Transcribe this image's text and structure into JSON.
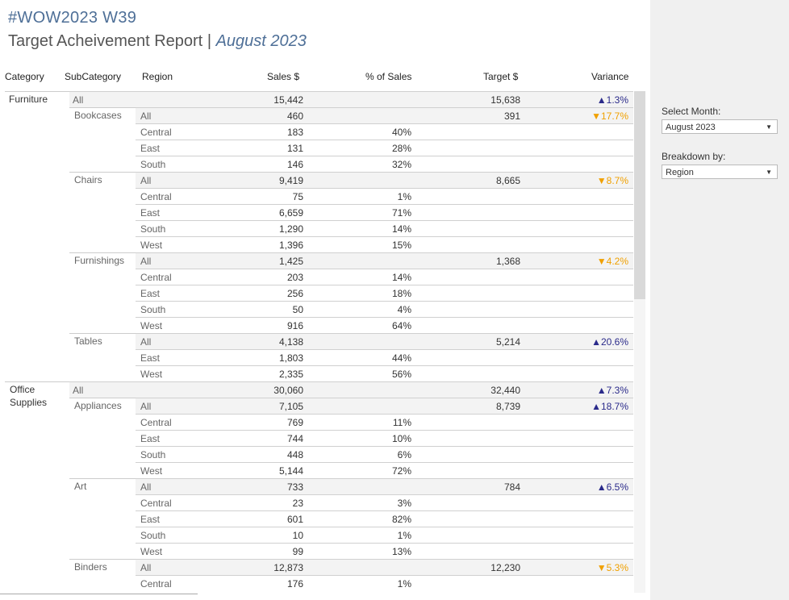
{
  "header": {
    "title": "#WOW2023 W39",
    "report": "Target Acheivement Report",
    "separator": "|",
    "month": "August 2023"
  },
  "columns": {
    "category": "Category",
    "subcategory": "SubCategory",
    "region": "Region",
    "sales": "Sales $",
    "pct": "% of Sales",
    "target": "Target $",
    "variance": "Variance"
  },
  "controls": {
    "month_label": "Select Month:",
    "month_value": "August 2023",
    "breakdown_label": "Breakdown by:",
    "breakdown_value": "Region"
  },
  "categories": [
    {
      "name": "Furniture",
      "row": 0
    },
    {
      "name": "Office\nSupplies",
      "row": 18
    }
  ],
  "subcategories": [
    {
      "name": "Bookcases",
      "row": 1
    },
    {
      "name": "Chairs",
      "row": 5
    },
    {
      "name": "Furnishings",
      "row": 10
    },
    {
      "name": "Tables",
      "row": 15
    },
    {
      "name": "Appliances",
      "row": 19
    },
    {
      "name": "Art",
      "row": 24
    },
    {
      "name": "Binders",
      "row": 29
    }
  ],
  "rows": [
    {
      "level": "cat",
      "label": "All",
      "sales": "15,442",
      "pct": "",
      "target": "15,638",
      "var": "▲1.3%",
      "dir": "up"
    },
    {
      "level": "sub",
      "label": "All",
      "sales": "460",
      "pct": "",
      "target": "391",
      "var": "▼17.7%",
      "dir": "down"
    },
    {
      "level": "reg",
      "label": "Central",
      "sales": "183",
      "pct": "40%",
      "target": "",
      "var": "",
      "dir": ""
    },
    {
      "level": "reg",
      "label": "East",
      "sales": "131",
      "pct": "28%",
      "target": "",
      "var": "",
      "dir": ""
    },
    {
      "level": "reg",
      "label": "South",
      "sales": "146",
      "pct": "32%",
      "target": "",
      "var": "",
      "dir": ""
    },
    {
      "level": "sub",
      "label": "All",
      "sales": "9,419",
      "pct": "",
      "target": "8,665",
      "var": "▼8.7%",
      "dir": "down"
    },
    {
      "level": "reg",
      "label": "Central",
      "sales": "75",
      "pct": "1%",
      "target": "",
      "var": "",
      "dir": ""
    },
    {
      "level": "reg",
      "label": "East",
      "sales": "6,659",
      "pct": "71%",
      "target": "",
      "var": "",
      "dir": ""
    },
    {
      "level": "reg",
      "label": "South",
      "sales": "1,290",
      "pct": "14%",
      "target": "",
      "var": "",
      "dir": ""
    },
    {
      "level": "reg",
      "label": "West",
      "sales": "1,396",
      "pct": "15%",
      "target": "",
      "var": "",
      "dir": ""
    },
    {
      "level": "sub",
      "label": "All",
      "sales": "1,425",
      "pct": "",
      "target": "1,368",
      "var": "▼4.2%",
      "dir": "down"
    },
    {
      "level": "reg",
      "label": "Central",
      "sales": "203",
      "pct": "14%",
      "target": "",
      "var": "",
      "dir": ""
    },
    {
      "level": "reg",
      "label": "East",
      "sales": "256",
      "pct": "18%",
      "target": "",
      "var": "",
      "dir": ""
    },
    {
      "level": "reg",
      "label": "South",
      "sales": "50",
      "pct": "4%",
      "target": "",
      "var": "",
      "dir": ""
    },
    {
      "level": "reg",
      "label": "West",
      "sales": "916",
      "pct": "64%",
      "target": "",
      "var": "",
      "dir": ""
    },
    {
      "level": "sub",
      "label": "All",
      "sales": "4,138",
      "pct": "",
      "target": "5,214",
      "var": "▲20.6%",
      "dir": "up"
    },
    {
      "level": "reg",
      "label": "East",
      "sales": "1,803",
      "pct": "44%",
      "target": "",
      "var": "",
      "dir": ""
    },
    {
      "level": "reg",
      "label": "West",
      "sales": "2,335",
      "pct": "56%",
      "target": "",
      "var": "",
      "dir": ""
    },
    {
      "level": "cat",
      "label": "All",
      "sales": "30,060",
      "pct": "",
      "target": "32,440",
      "var": "▲7.3%",
      "dir": "up"
    },
    {
      "level": "sub",
      "label": "All",
      "sales": "7,105",
      "pct": "",
      "target": "8,739",
      "var": "▲18.7%",
      "dir": "up"
    },
    {
      "level": "reg",
      "label": "Central",
      "sales": "769",
      "pct": "11%",
      "target": "",
      "var": "",
      "dir": ""
    },
    {
      "level": "reg",
      "label": "East",
      "sales": "744",
      "pct": "10%",
      "target": "",
      "var": "",
      "dir": ""
    },
    {
      "level": "reg",
      "label": "South",
      "sales": "448",
      "pct": "6%",
      "target": "",
      "var": "",
      "dir": ""
    },
    {
      "level": "reg",
      "label": "West",
      "sales": "5,144",
      "pct": "72%",
      "target": "",
      "var": "",
      "dir": ""
    },
    {
      "level": "sub",
      "label": "All",
      "sales": "733",
      "pct": "",
      "target": "784",
      "var": "▲6.5%",
      "dir": "up"
    },
    {
      "level": "reg",
      "label": "Central",
      "sales": "23",
      "pct": "3%",
      "target": "",
      "var": "",
      "dir": ""
    },
    {
      "level": "reg",
      "label": "East",
      "sales": "601",
      "pct": "82%",
      "target": "",
      "var": "",
      "dir": ""
    },
    {
      "level": "reg",
      "label": "South",
      "sales": "10",
      "pct": "1%",
      "target": "",
      "var": "",
      "dir": ""
    },
    {
      "level": "reg",
      "label": "West",
      "sales": "99",
      "pct": "13%",
      "target": "",
      "var": "",
      "dir": ""
    },
    {
      "level": "sub",
      "label": "All",
      "sales": "12,873",
      "pct": "",
      "target": "12,230",
      "var": "▼5.3%",
      "dir": "down"
    },
    {
      "level": "reg",
      "label": "Central",
      "sales": "176",
      "pct": "1%",
      "target": "",
      "var": "",
      "dir": ""
    }
  ]
}
